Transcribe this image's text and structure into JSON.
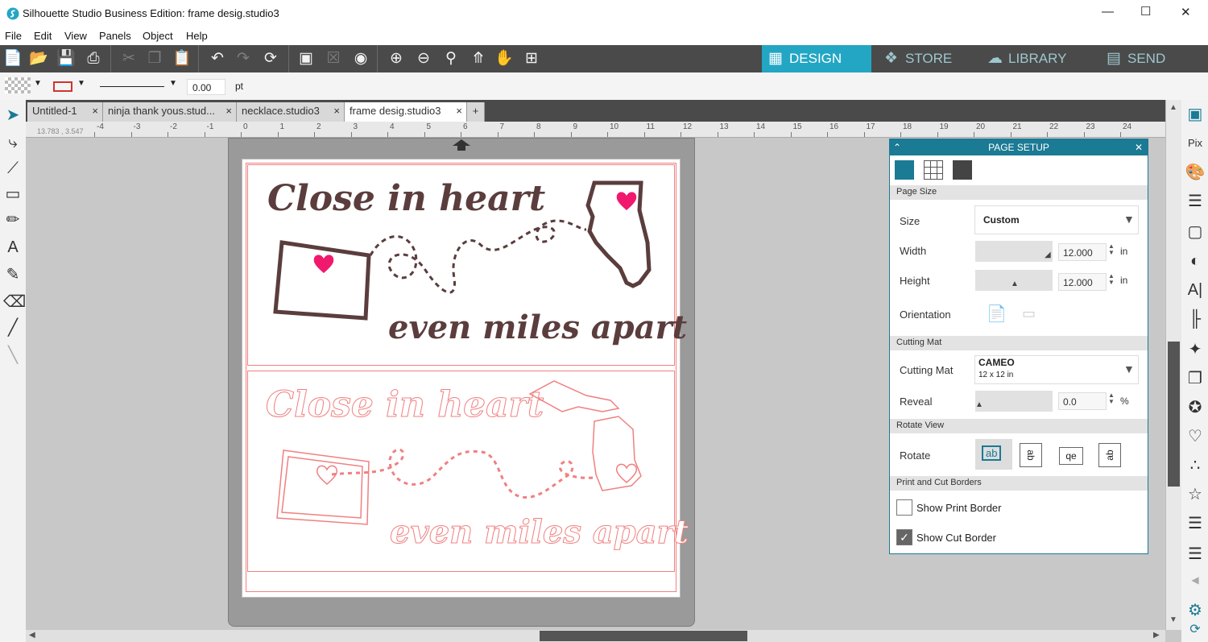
{
  "window": {
    "title": "Silhouette Studio Business Edition: frame desig.studio3",
    "minimize": "—",
    "maximize": "☐",
    "close": "✕"
  },
  "menu": [
    "File",
    "Edit",
    "View",
    "Panels",
    "Object",
    "Help"
  ],
  "nav": {
    "design": "DESIGN",
    "store": "STORE",
    "library": "LIBRARY",
    "send": "SEND"
  },
  "propbar": {
    "line_width": "0.00",
    "unit": "pt"
  },
  "doc_tabs": [
    {
      "label": "Untitled-1"
    },
    {
      "label": "ninja thank yous.stud..."
    },
    {
      "label": "necklace.studio3"
    },
    {
      "label": "frame desig.studio3",
      "active": true
    }
  ],
  "ruler": {
    "coords": "13.783 , 3.547",
    "labels": [
      "-4",
      "-3",
      "-2",
      "-1",
      "0",
      "1",
      "2",
      "3",
      "4",
      "5",
      "6",
      "7",
      "8",
      "9",
      "10",
      "11",
      "12",
      "13",
      "14",
      "15",
      "16",
      "17",
      "18",
      "19",
      "20",
      "21",
      "22",
      "23",
      "24"
    ]
  },
  "design": {
    "top": {
      "line1": "Close in heart",
      "line2": "even miles apart",
      "fill": "#5b3d3d",
      "heart": "#f0196e"
    },
    "bottom": {
      "line1": "Close in heart",
      "line2": "even miles apart",
      "stroke": "#f08080"
    }
  },
  "page_setup": {
    "title": "PAGE SETUP",
    "page_size_section": "Page Size",
    "size_label": "Size",
    "size_value": "Custom",
    "width_label": "Width",
    "width_value": "12.000",
    "width_unit": "in",
    "height_label": "Height",
    "height_value": "12.000",
    "height_unit": "in",
    "orientation_label": "Orientation",
    "cutting_mat_section": "Cutting Mat",
    "cutting_mat_label": "Cutting Mat",
    "mat_name": "CAMEO",
    "mat_size": "12 x 12 in",
    "reveal_label": "Reveal",
    "reveal_value": "0.0",
    "reveal_unit": "%",
    "rotate_section": "Rotate View",
    "rotate_label": "Rotate",
    "rotate_options": [
      "ab",
      "ab",
      "qe",
      "ab"
    ],
    "borders_section": "Print and Cut Borders",
    "show_print_border": "Show Print Border",
    "show_print_border_checked": false,
    "show_cut_border": "Show Cut Border",
    "show_cut_border_checked": true
  },
  "colors": {
    "accent": "#23a6c4",
    "panel": "#1b7a94",
    "toolbar": "#4a4a4a"
  }
}
